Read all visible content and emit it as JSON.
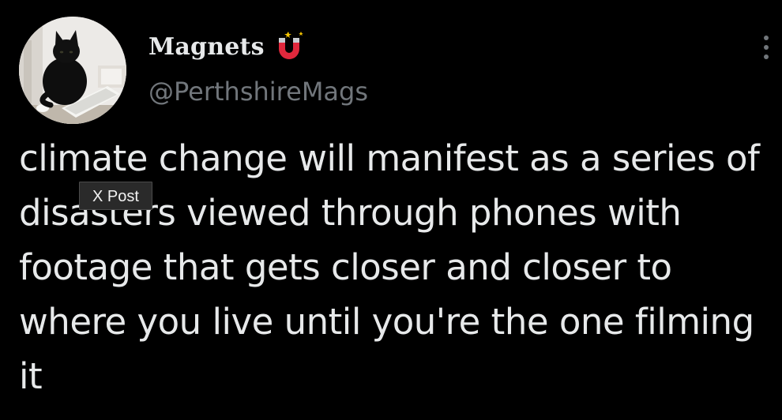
{
  "author": {
    "display_name": "Magnets",
    "handle": "@PerthshireMags",
    "avatar_icon": "black-cat-avatar",
    "name_emoji": "magnet-icon"
  },
  "tweet": {
    "text": "climate change will manifest as a series of disasters viewed through phones with footage that gets closer and closer to where you live until you're the one filming it"
  },
  "watermark": {
    "label": "X Post"
  },
  "actions": {
    "more_icon": "more-options-icon"
  },
  "colors": {
    "background": "#000000",
    "text_primary": "#E7E9EA",
    "text_secondary": "#71767B",
    "magnet_red": "#E0283C"
  }
}
